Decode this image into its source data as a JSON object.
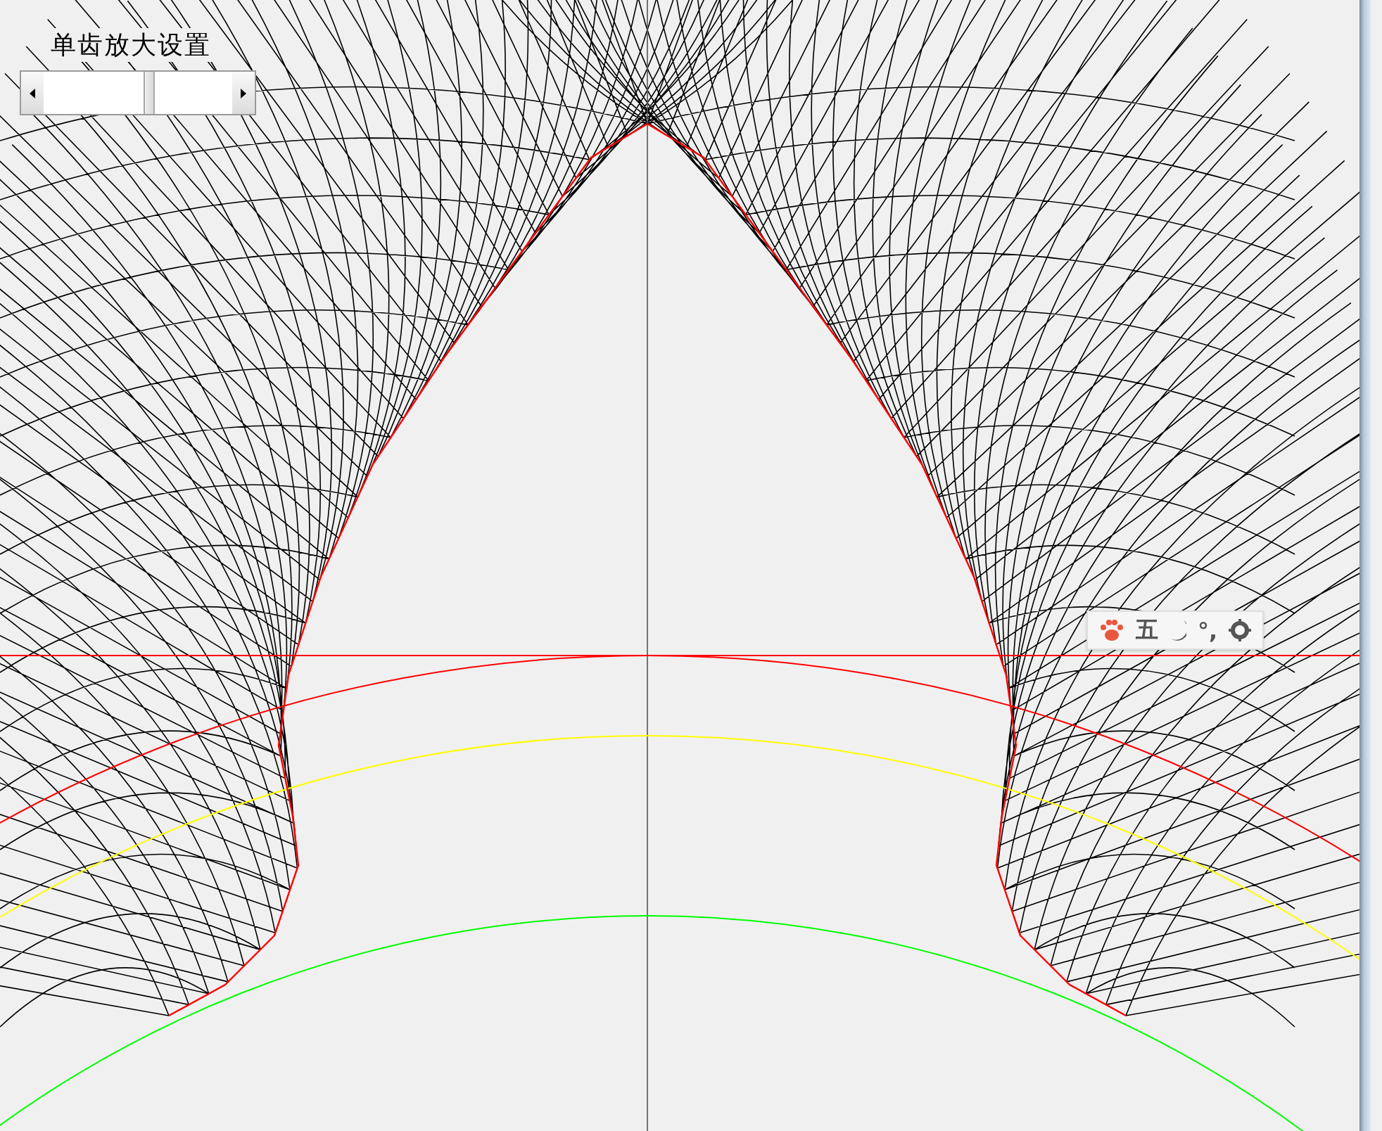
{
  "settings": {
    "title": "单齿放大设置",
    "slider": {
      "level": 0.56
    }
  },
  "ime_toolbar": {
    "mode_label": "五",
    "punctuation_label": "°,"
  }
}
